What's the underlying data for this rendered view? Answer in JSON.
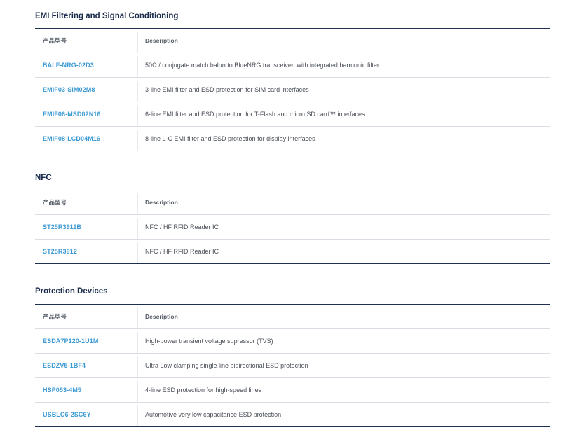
{
  "sections": [
    {
      "title": "EMI Filtering and Signal Conditioning",
      "headers": {
        "part": "产品型号",
        "description": "Description"
      },
      "rows": [
        {
          "part": "BALF-NRG-02D3",
          "description": "50Ω / conjugate match balun to BlueNRG transceiver, with integrated harmonic filter"
        },
        {
          "part": "EMIF03-SIM02M8",
          "description": "3-line EMI filter and ESD protection for SIM card interfaces"
        },
        {
          "part": "EMIF06-MSD02N16",
          "description": "6-line EMI filter and ESD protection for T-Flash and micro SD card™ interfaces"
        },
        {
          "part": "EMIF08-LCD04M16",
          "description": "8-line L-C EMI filter and ESD protection for display interfaces"
        }
      ]
    },
    {
      "title": "NFC",
      "headers": {
        "part": "产品型号",
        "description": "Description"
      },
      "rows": [
        {
          "part": "ST25R3911B",
          "description": "NFC / HF RFID Reader IC"
        },
        {
          "part": "ST25R3912",
          "description": "NFC / HF RFID Reader IC"
        }
      ]
    },
    {
      "title": "Protection Devices",
      "headers": {
        "part": "产品型号",
        "description": "Description"
      },
      "rows": [
        {
          "part": "ESDA7P120-1U1M",
          "description": "High-power transient voltage supressor (TVS)"
        },
        {
          "part": "ESDZV5-1BF4",
          "description": "Ultra Low clamping single line bidirectional ESD protection"
        },
        {
          "part": "HSP053-4M5",
          "description": "4-line ESD protection for high-speed lines"
        },
        {
          "part": "USBLC6-2SC6Y",
          "description": "Automotive very low capacitance ESD protection"
        }
      ]
    }
  ]
}
